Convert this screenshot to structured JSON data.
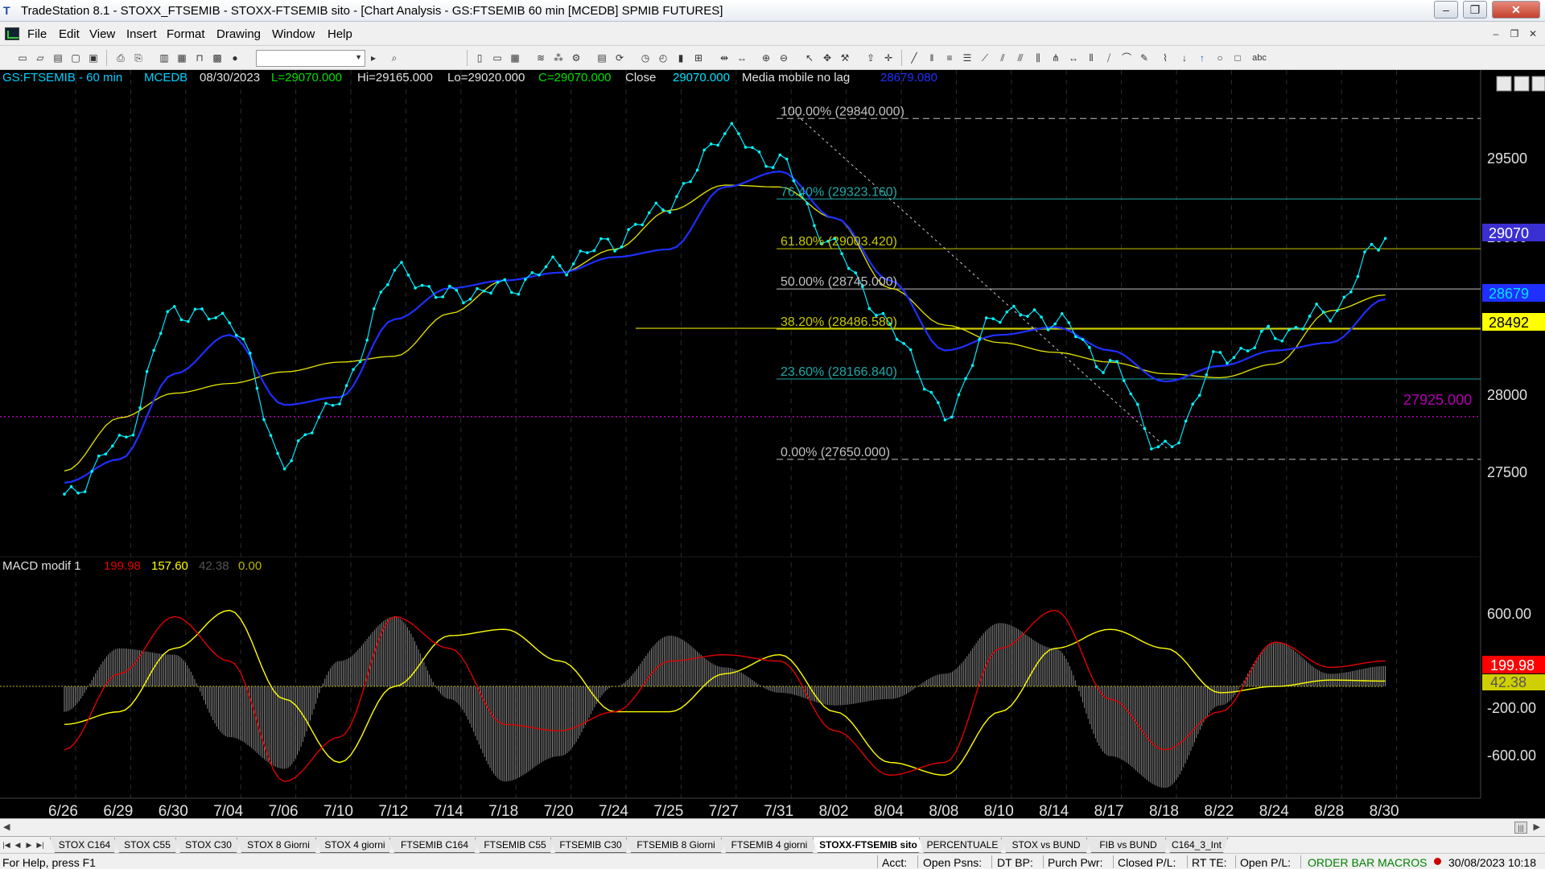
{
  "window": {
    "title": "TradeStation 8.1 - STOXX_FTSEMIB - STOXX-FTSEMIB sito - [Chart Analysis - GS:FTSEMIB  60 min  [MCEDB] SPMIB FUTURES]",
    "app_icon": "T"
  },
  "menu": [
    "File",
    "Edit",
    "View",
    "Insert",
    "Format",
    "Drawing",
    "Window",
    "Help"
  ],
  "chart_header": {
    "symbol": "GS:FTSEMIB - 60 min",
    "session": "MCEDB",
    "date": "08/30/2023",
    "last": "L=29070.000",
    "high": "Hi=29165.000",
    "low": "Lo=29020.000",
    "close": "C=29070.000",
    "close_label": "Close",
    "close_value": "29070.000",
    "ma_label": "Media mobile no lag",
    "ma_value": "28679.080"
  },
  "macd_header": {
    "name": "MACD modif 1",
    "v1": "199.98",
    "v2": "157.60",
    "v3": "42.38",
    "v4": "0.00"
  },
  "fib_labels": [
    "100.00% (29840.000)",
    "76.40% (29323.160)",
    "61.80% (29003.420)",
    "50.00% (28745.000)",
    "38.20% (28486.580)",
    "23.60% (28166.840)",
    "0.00% (27650.000)"
  ],
  "price_axis": [
    "29500",
    "29000",
    "28000",
    "27500"
  ],
  "price_markers": {
    "last": "29070",
    "blue_ma": "28679",
    "yellow_line": "28492",
    "purple_line": "27925.000"
  },
  "macd_axis": [
    "600.00",
    "-200.00",
    "-600.00"
  ],
  "macd_markers": {
    "red": "199.98",
    "yellow": "42.38"
  },
  "date_axis": [
    "6/26",
    "6/29",
    "6/30",
    "7/04",
    "7/06",
    "7/10",
    "7/12",
    "7/14",
    "7/18",
    "7/20",
    "7/24",
    "7/25",
    "7/27",
    "7/31",
    "8/02",
    "8/04",
    "8/08",
    "8/10",
    "8/14",
    "8/17",
    "8/18",
    "8/22",
    "8/24",
    "8/28",
    "8/30"
  ],
  "chart_data": {
    "type": "line",
    "series": [
      {
        "name": "GS:FTSEMIB - 60 min",
        "color": "#00ffff",
        "x": [
          "6/26",
          "6/29",
          "6/30",
          "7/04",
          "7/06",
          "7/10",
          "7/12",
          "7/14",
          "7/18",
          "7/20",
          "7/24",
          "7/25",
          "7/27",
          "7/31",
          "8/02",
          "8/04",
          "8/08",
          "8/10",
          "8/14",
          "8/17",
          "8/18",
          "8/22",
          "8/24",
          "8/28",
          "8/30"
        ],
        "values": [
          27400,
          27750,
          28600,
          28550,
          27650,
          28050,
          28850,
          28700,
          28750,
          28900,
          29050,
          29300,
          29750,
          29550,
          29000,
          28500,
          27950,
          28600,
          28550,
          28250,
          27700,
          28300,
          28450,
          28600,
          29070
        ]
      },
      {
        "name": "Media mobile no lag",
        "color": "#1f2fff",
        "x": [
          "6/26",
          "6/29",
          "6/30",
          "7/04",
          "7/06",
          "7/10",
          "7/12",
          "7/14",
          "7/18",
          "7/20",
          "7/24",
          "7/25",
          "7/27",
          "7/31",
          "8/02",
          "8/04",
          "8/08",
          "8/10",
          "8/14",
          "8/17",
          "8/18",
          "8/22",
          "8/24",
          "8/28",
          "8/30"
        ],
        "values": [
          27500,
          27650,
          28200,
          28450,
          28000,
          28050,
          28550,
          28750,
          28800,
          28850,
          28950,
          29000,
          29400,
          29500,
          29200,
          28800,
          28350,
          28450,
          28500,
          28350,
          28150,
          28250,
          28350,
          28400,
          28679
        ]
      }
    ],
    "ylim": [
      27050,
      30100
    ],
    "fibonacci": [
      {
        "level": "100.00%",
        "price": 29840
      },
      {
        "level": "76.40%",
        "price": 29323.16
      },
      {
        "level": "61.80%",
        "price": 29003.42
      },
      {
        "level": "50.00%",
        "price": 28745
      },
      {
        "level": "38.20%",
        "price": 28486.58
      },
      {
        "level": "23.60%",
        "price": 28166.84
      },
      {
        "level": "0.00%",
        "price": 27650
      }
    ],
    "horizontal_lines": [
      {
        "price": 28492,
        "color": "#ffff00"
      },
      {
        "price": 27925,
        "color": "#b000b0"
      }
    ],
    "macd": {
      "name": "MACD modif 1",
      "x": [
        "6/26",
        "6/29",
        "6/30",
        "7/04",
        "7/06",
        "7/10",
        "7/12",
        "7/14",
        "7/18",
        "7/20",
        "7/24",
        "7/25",
        "7/27",
        "7/31",
        "8/02",
        "8/04",
        "8/08",
        "8/10",
        "8/14",
        "8/17",
        "8/18",
        "8/22",
        "8/24",
        "8/28",
        "8/30"
      ],
      "line": [
        -500,
        100,
        550,
        200,
        -750,
        -400,
        550,
        300,
        -300,
        -350,
        -200,
        200,
        250,
        200,
        -350,
        -700,
        -600,
        300,
        600,
        -100,
        -500,
        -200,
        350,
        150,
        200
      ],
      "signal": [
        -300,
        -200,
        300,
        600,
        -100,
        -600,
        0,
        400,
        450,
        200,
        -200,
        -200,
        100,
        250,
        -200,
        -600,
        -700,
        -200,
        300,
        450,
        300,
        -50,
        0,
        50,
        42
      ],
      "histogram": [
        -200,
        300,
        250,
        -400,
        -650,
        200,
        550,
        -100,
        -750,
        -550,
        0,
        400,
        150,
        -50,
        -150,
        -100,
        100,
        500,
        300,
        -550,
        -800,
        -150,
        350,
        100,
        160
      ],
      "ylim": [
        -850,
        800
      ],
      "line_color": "#e00000",
      "signal_color": "#ffff00"
    }
  },
  "tabs": [
    "STOX C164",
    "STOX C55",
    "STOX  C30",
    "STOX  8 Giorni",
    "STOX 4 giorni",
    "FTSEMIB C164",
    "FTSEMIB C55",
    "FTSEMIB C30",
    "FTSEMIB  8 Giorni",
    "FTSEMIB  4 giorni",
    "STOXX-FTSEMIB sito",
    "PERCENTUALE",
    "STOX vs BUND",
    "FIB vs BUND",
    "C164_3_Int"
  ],
  "active_tab": "STOXX-FTSEMIB sito",
  "status": {
    "help": "For Help, press F1",
    "acct": "Acct:",
    "open_psns": "Open Psns:",
    "dt_bp": "DT BP:",
    "purch_pwr": "Purch Pwr:",
    "closed_pl": "Closed P/L:",
    "rt_te": "RT TE:",
    "open_pl": "Open P/L:",
    "order_bar": "ORDER BAR",
    "macros": "MACROS",
    "datetime": "30/08/2023 10:18"
  },
  "colors": {
    "price": "#00ffff",
    "ma": "#1f2fff",
    "ma_slow": "#e6e600",
    "fib_teal": "#20a8a8",
    "fib_yellow": "#c8c800",
    "macd_line": "#e00000",
    "macd_signal": "#ffff00",
    "status_green": "#008000"
  }
}
